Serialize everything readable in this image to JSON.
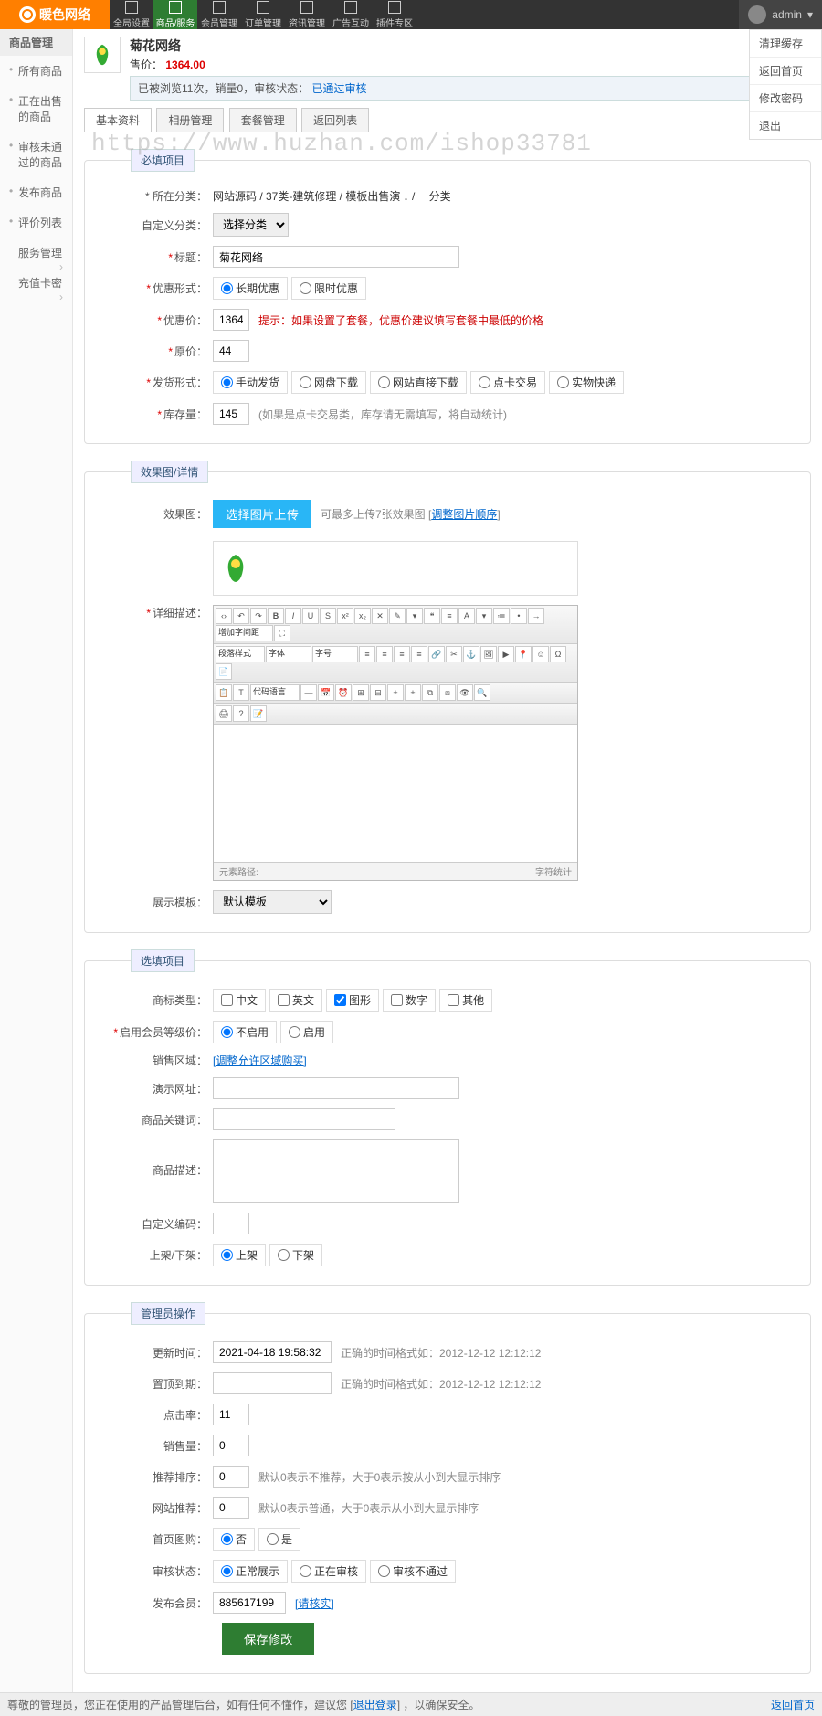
{
  "brand": "暖色网络",
  "watermark": "https://www.huzhan.com/ishop33781",
  "topnav": [
    {
      "label": "全局设置"
    },
    {
      "label": "商品/服务"
    },
    {
      "label": "会员管理"
    },
    {
      "label": "订单管理"
    },
    {
      "label": "资讯管理"
    },
    {
      "label": "广告互动"
    },
    {
      "label": "插件专区"
    }
  ],
  "user": {
    "name": "admin"
  },
  "user_menu": [
    "清理缓存",
    "返回首页",
    "修改密码",
    "退出"
  ],
  "sidebar": {
    "groups": [
      {
        "title": "商品管理",
        "items": [
          "所有商品",
          "正在出售的商品",
          "审核未通过的商品",
          "发布商品",
          "评价列表"
        ]
      },
      {
        "title": "服务管理",
        "items": []
      },
      {
        "title": "充值卡密",
        "items": []
      }
    ]
  },
  "product": {
    "title": "菊花网络",
    "price_label": "售价：",
    "price": "1364.00",
    "meta_views": "已被浏览11次，销量0，审核状态：",
    "meta_status": "已通过审核"
  },
  "tabs": [
    "基本资料",
    "相册管理",
    "套餐管理",
    "返回列表"
  ],
  "sections": {
    "required": "必填项目",
    "gallery": "效果图/详情",
    "optional": "选填项目",
    "admin": "管理员操作"
  },
  "fields": {
    "category_label": "* 所在分类：",
    "category_value": "  网站源码 / 37类-建筑修理 / 模板出售演 ↓ / 一分类",
    "custom_cat_label": "自定义分类：",
    "custom_cat_select": "选择分类",
    "title_label": "标题：",
    "title_value": "菊花网络",
    "promo_label": "优惠形式：",
    "promo_opts": [
      "长期优惠",
      "限时优惠"
    ],
    "promo_price_label": "优惠价：",
    "promo_price_value": "1364",
    "promo_hint": "提示：如果设置了套餐，优惠价建议填写套餐中最低的价格",
    "orig_price_label": "原价：",
    "orig_price_value": "44",
    "delivery_label": "发货形式：",
    "delivery_opts": [
      "手动发货",
      "网盘下载",
      "网站直接下载",
      "点卡交易",
      "实物快递"
    ],
    "stock_label": "库存量：",
    "stock_value": "145",
    "stock_hint": "(如果是点卡交易类，库存请无需填写，将自动统计)",
    "gallery_label": "效果图：",
    "upload_btn": "选择图片上传",
    "upload_hint_pre": "可最多上传7张效果图  [",
    "upload_hint_link": "调整图片顺序",
    "upload_hint_post": "]",
    "detail_label": "详细描述：",
    "editor_style": "段落样式",
    "editor_font": "字体",
    "editor_size": "字号",
    "editor_code": "代码语言",
    "editor_customfont": "增加字间距",
    "editor_path": "元素路径:",
    "editor_count": "字符统计",
    "template_label": "展示模板：",
    "template_value": "默认模板",
    "trademark_label": "商标类型：",
    "trademark_opts": [
      "中文",
      "英文",
      "图形",
      "数字",
      "其他"
    ],
    "enable_level_label": "启用会员等级价：",
    "enable_level_opts": [
      "不启用",
      "启用"
    ],
    "sale_area_label": "销售区域：",
    "sale_area_link": "[调整允许区域购买]",
    "demo_url_label": "演示网址：",
    "keywords_label": "商品关键词：",
    "desc_label": "商品描述：",
    "custom_code_label": "自定义编码：",
    "shelf_label": "上架/下架：",
    "shelf_opts": [
      "上架",
      "下架"
    ],
    "update_time_label": "更新时间：",
    "update_time_value": "2021-04-18 19:58:32",
    "update_hint": "正确的时间格式如：2012-12-12 12:12:12",
    "top_expire_label": "置顶到期：",
    "top_expire_hint": "正确的时间格式如：2012-12-12 12:12:12",
    "clicks_label": "点击率：",
    "clicks_value": "11",
    "sales_label": "销售量：",
    "sales_value": "0",
    "rec_sort_label": "推荐排序：",
    "rec_sort_value": "0",
    "rec_sort_hint": "默认0表示不推荐，大于0表示按从小到大显示排序",
    "web_rec_label": "网站推荐：",
    "web_rec_value": "0",
    "web_rec_hint": "默认0表示普通，大于0表示从小到大显示排序",
    "home_rec_label": "首页图购：",
    "home_rec_opts": [
      "否",
      "是"
    ],
    "audit_label": "审核状态：",
    "audit_opts": [
      "正常展示",
      "正在审核",
      "审核不通过"
    ],
    "publisher_label": "发布会员：",
    "publisher_value": "885617199",
    "publisher_hint": "[请核实]",
    "submit": "保存修改"
  },
  "footer": {
    "left_pre": "尊敬的管理员，您正在使用的产品管理后台，如有任何不懂作，建议您 [",
    "left_link": "退出登录",
    "left_post": "] ，以确保安全。",
    "right": "返回首页"
  }
}
